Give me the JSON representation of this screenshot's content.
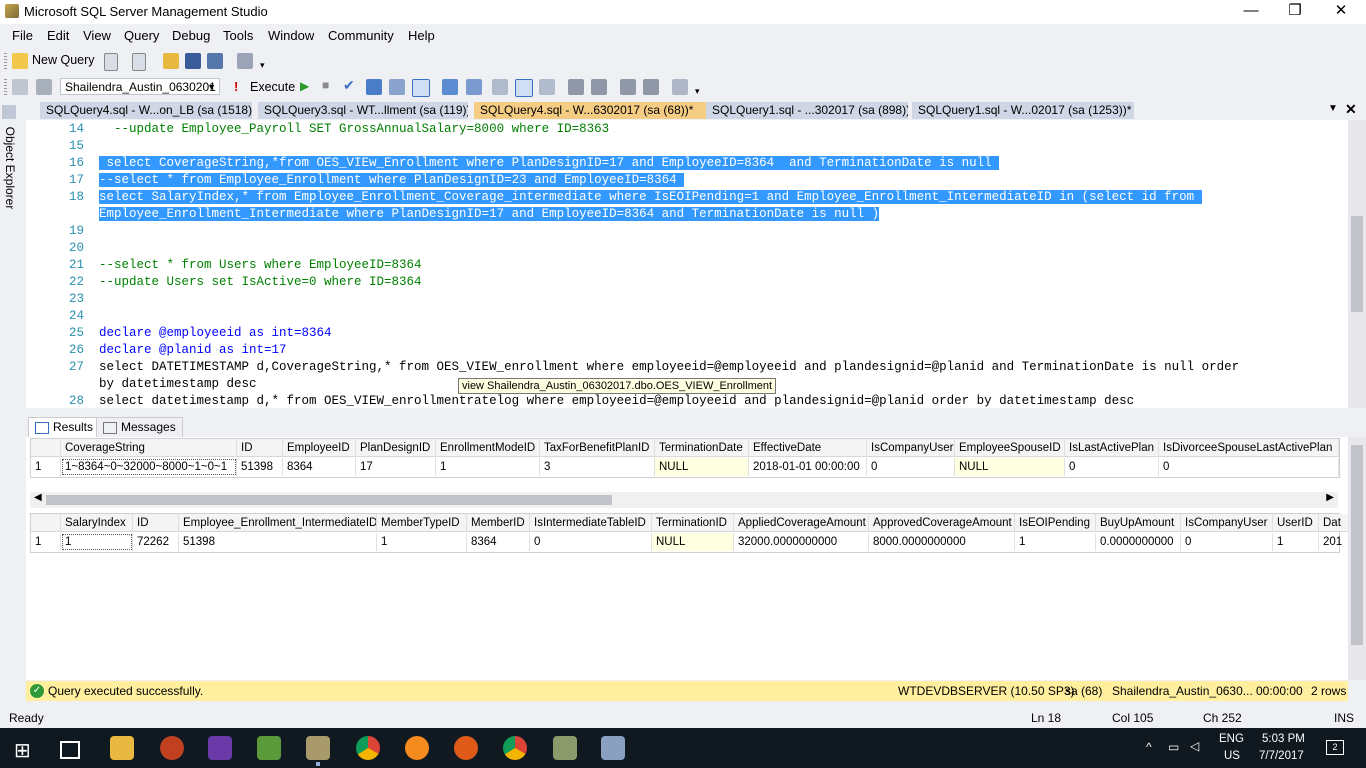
{
  "window": {
    "title": "Microsoft SQL Server Management Studio",
    "min": "—",
    "restore": "❐",
    "close": "✕"
  },
  "menu": [
    "File",
    "Edit",
    "View",
    "Query",
    "Debug",
    "Tools",
    "Window",
    "Community",
    "Help"
  ],
  "toolbar": {
    "new_query": "New Query",
    "database": "Shailendra_Austin_0630201",
    "execute": "Execute"
  },
  "side_panel": {
    "label": "Object Explorer"
  },
  "tabs": [
    {
      "label": "SQLQuery4.sql - W...on_LB (sa (1518))*",
      "active": false
    },
    {
      "label": "SQLQuery3.sql - WT...llment (sa (119))*",
      "active": false
    },
    {
      "label": "SQLQuery4.sql - W...6302017 (sa (68))*",
      "active": true
    },
    {
      "label": "SQLQuery1.sql - ...302017 (sa (898))",
      "active": false
    },
    {
      "label": "SQLQuery1.sql - W...02017 (sa (1253))*",
      "active": false
    }
  ],
  "editor": {
    "lines": [
      {
        "n": "14",
        "t": "  --update Employee_Payroll SET GrossAnnualSalary=8000 where ID=8363",
        "cls": "cm",
        "sel": false
      },
      {
        "n": "15",
        "t": "",
        "cls": "",
        "sel": false
      },
      {
        "n": "16",
        "t": " select CoverageString,*from OES_VIEw_Enrollment where PlanDesignID=17 and EmployeeID=8364  and TerminationDate is null ",
        "cls": "",
        "sel": true
      },
      {
        "n": "17",
        "t": "--select * from Employee_Enrollment where PlanDesignID=23 and EmployeeID=8364 ",
        "cls": "",
        "sel": true
      },
      {
        "n": "18",
        "t": "select SalaryIndex,* from Employee_Enrollment_Coverage_intermediate where IsEOIPending=1 and Employee_Enrollment_IntermediateID in (select id from ",
        "cls": "",
        "sel": true
      },
      {
        "n": "",
        "t": "Employee_Enrollment_Intermediate where PlanDesignID=17 and EmployeeID=8364 and TerminationDate is null )",
        "cls": "",
        "sel": true
      },
      {
        "n": "19",
        "t": "",
        "cls": "",
        "sel": false
      },
      {
        "n": "20",
        "t": "",
        "cls": "",
        "sel": false
      },
      {
        "n": "21",
        "t": "--select * from Users where EmployeeID=8364",
        "cls": "cm",
        "sel": false
      },
      {
        "n": "22",
        "t": "--update Users set IsActive=0 where ID=8364",
        "cls": "cm",
        "sel": false
      },
      {
        "n": "23",
        "t": "",
        "cls": "",
        "sel": false
      },
      {
        "n": "24",
        "t": "",
        "cls": "",
        "sel": false
      },
      {
        "n": "25",
        "t": "declare @employeeid as int=8364",
        "cls": "kw",
        "sel": false
      },
      {
        "n": "26",
        "t": "declare @planid as int=17",
        "cls": "kw",
        "sel": false
      },
      {
        "n": "27",
        "t": "select DATETIMESTAMP d,CoverageString,* from OES_VIEW_enrollment where employeeid=@employeeid and plandesignid=@planid and TerminationDate is null order",
        "cls": "",
        "sel": false
      },
      {
        "n": "",
        "t": "by datetimestamp desc",
        "cls": "",
        "sel": false
      },
      {
        "n": "28",
        "t": "select datetimestamp d,* from OES_VIEW_enrollmentratelog where employeeid=@employeeid and plandesignid=@planid order by datetimestamp desc",
        "cls": "",
        "sel": false
      }
    ],
    "tooltip": "view Shailendra_Austin_06302017.dbo.OES_VIEW_Enrollment"
  },
  "results_tabs": [
    "Results",
    "Messages"
  ],
  "grid1": {
    "columns": [
      "CoverageString",
      "ID",
      "EmployeeID",
      "PlanDesignID",
      "EnrollmentModeID",
      "TaxForBenefitPlanID",
      "TerminationDate",
      "EffectiveDate",
      "IsCompanyUser",
      "EmployeeSpouseID",
      "IsLastActivePlan",
      "IsDivorceeSpouseLastActivePlan"
    ],
    "rownum": "1",
    "row": [
      "1~8364~0~32000~8000~1~0~1",
      "51398",
      "8364",
      "17",
      "1",
      "3",
      "NULL",
      "2018-01-01 00:00:00",
      "0",
      "NULL",
      "0",
      "0"
    ]
  },
  "grid2": {
    "columns": [
      "SalaryIndex",
      "ID",
      "Employee_Enrollment_IntermediateID",
      "MemberTypeID",
      "MemberID",
      "IsIntermediateTableID",
      "TerminationID",
      "AppliedCoverageAmount",
      "ApprovedCoverageAmount",
      "IsEOIPending",
      "BuyUpAmount",
      "IsCompanyUser",
      "UserID",
      "Dat"
    ],
    "rownum": "1",
    "row": [
      "1",
      "72262",
      "51398",
      "1",
      "8364",
      "0",
      "NULL",
      "32000.0000000000",
      "8000.0000000000",
      "1",
      "0.0000000000",
      "0",
      "1",
      "201"
    ]
  },
  "status": {
    "message": "Query executed successfully.",
    "server": "WTDEVDBSERVER (10.50 SP3)",
    "user": "sa (68)",
    "db": "Shailendra_Austin_0630...",
    "time": "00:00:00",
    "rows": "2 rows"
  },
  "ready": {
    "left": "Ready",
    "ln": "Ln 18",
    "col": "Col 105",
    "ch": "Ch 252",
    "mode": "INS"
  },
  "taskbar": {
    "lang1": "ENG",
    "lang2": "US",
    "time": "5:03 PM",
    "date": "7/7/2017",
    "badge": "2"
  }
}
